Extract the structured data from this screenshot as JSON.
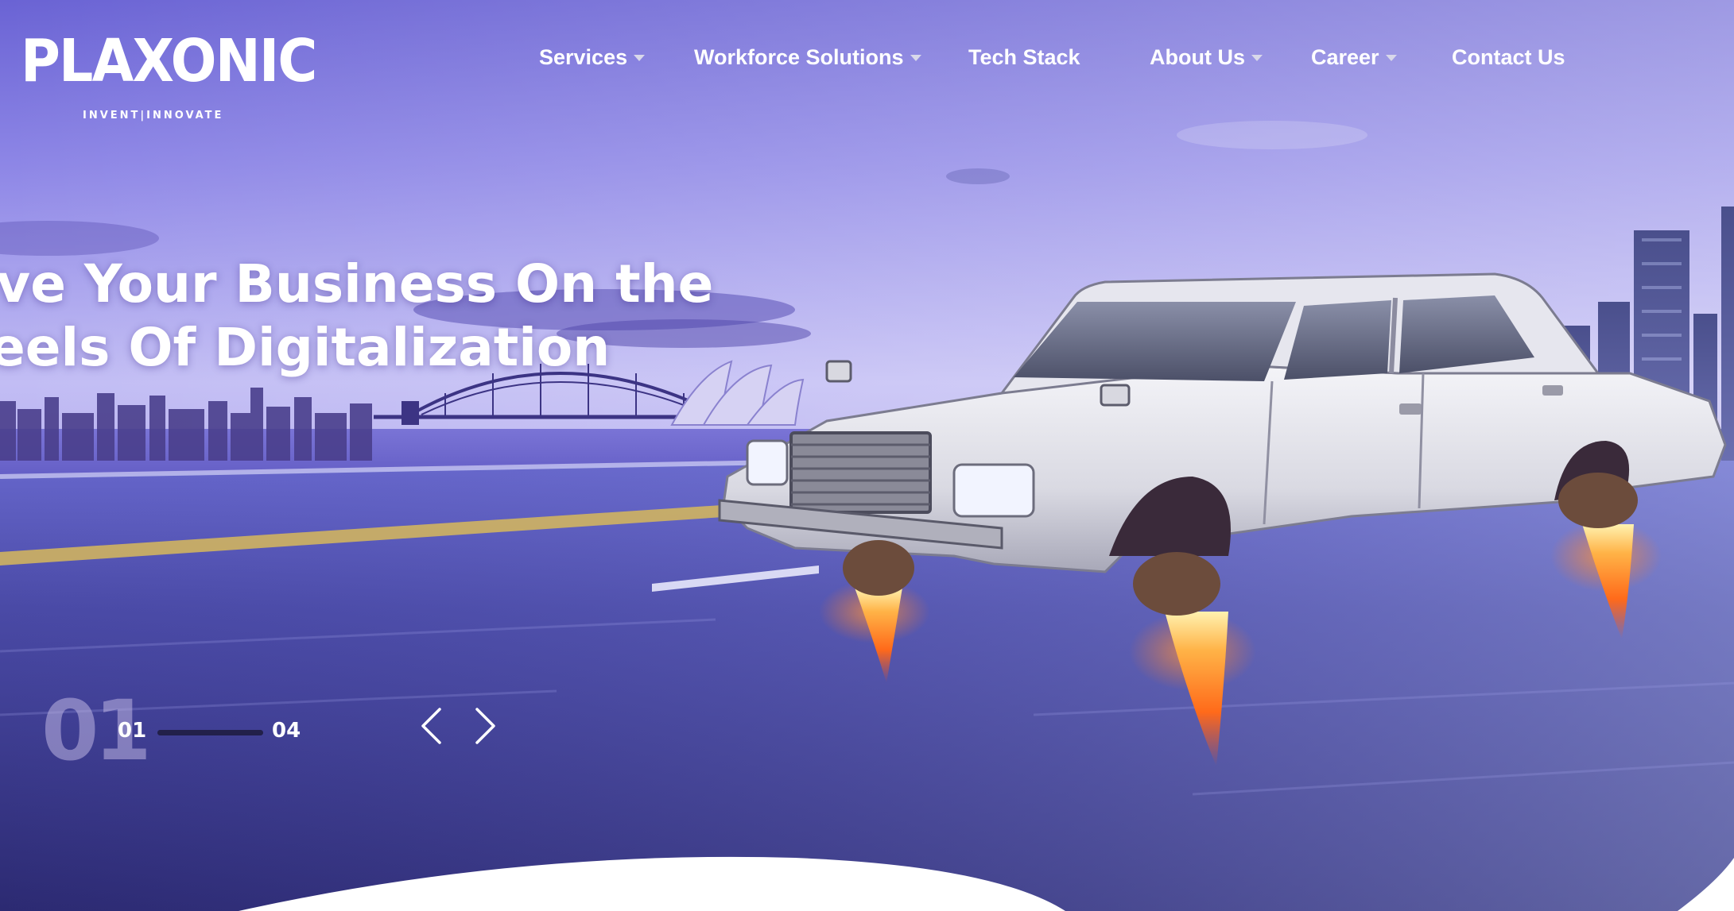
{
  "brand": {
    "name": "PLAXONIC",
    "tagline": "INVENT|INNOVATE"
  },
  "nav": {
    "items": [
      {
        "label": "Services",
        "has_dropdown": true
      },
      {
        "label": "Workforce Solutions",
        "has_dropdown": true
      },
      {
        "label": "Tech Stack",
        "has_dropdown": false
      },
      {
        "label": "About Us",
        "has_dropdown": true
      },
      {
        "label": "Career",
        "has_dropdown": true
      },
      {
        "label": "Contact Us",
        "has_dropdown": false
      }
    ]
  },
  "hero": {
    "headline_line1": "rive Your Business On the",
    "headline_line2": "heels Of Digitalization",
    "slide_big": "01",
    "slide_current": "01",
    "slide_total": "04",
    "progress_fraction": 1.0,
    "prev_icon": "chevron-left-icon",
    "next_icon": "chevron-right-icon"
  },
  "colors": {
    "text": "#ffffff",
    "sky_top": "#6b63d6",
    "sky_mid": "#a9a2ee",
    "road": "#3a3a8a",
    "progress": "#22204a"
  }
}
